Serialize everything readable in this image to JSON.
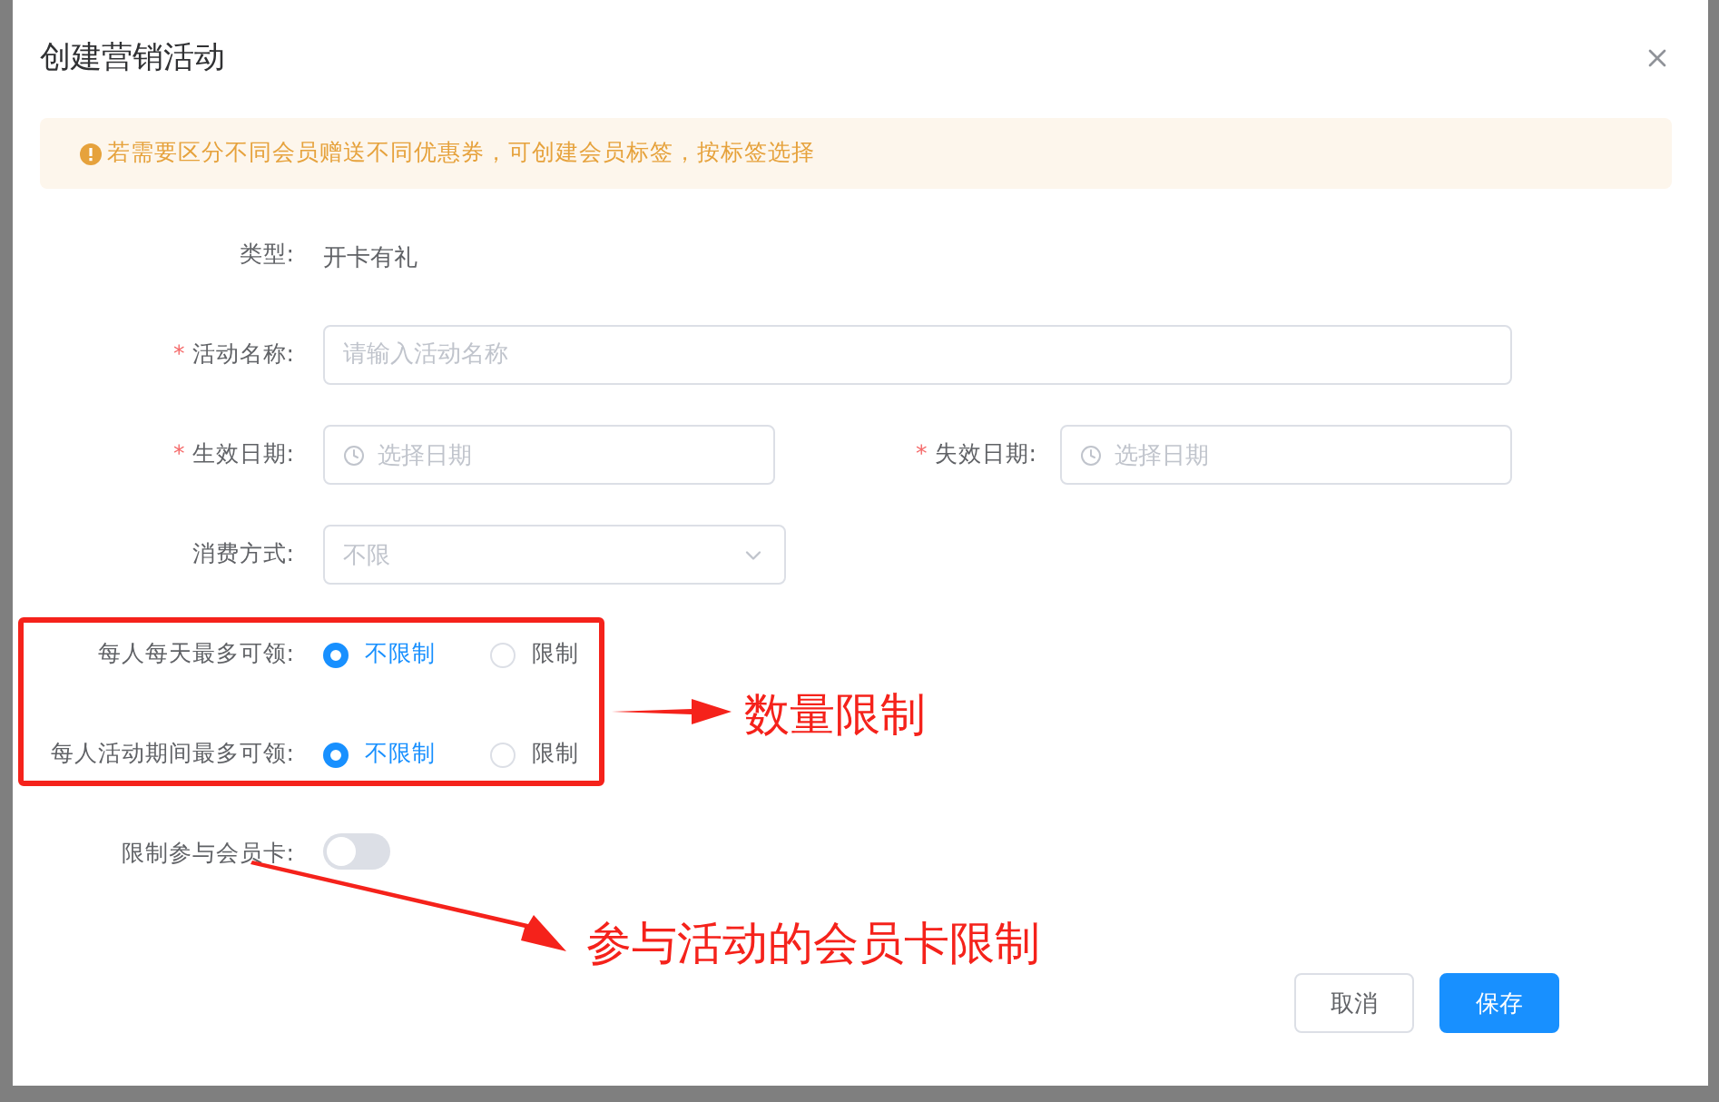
{
  "dialog": {
    "title": "创建营销活动"
  },
  "alert": {
    "text": "若需要区分不同会员赠送不同优惠券，可创建会员标签，按标签选择"
  },
  "form": [
    {
      "kind": "static",
      "label": "类型:",
      "value": "开卡有礼"
    },
    {
      "kind": "input",
      "mark": "*",
      "label": "活动名称:",
      "placeholder": "请输入活动名称"
    },
    {
      "kind": "dates",
      "mark": "*",
      "label": "生效日期:",
      "placeholder": "选择日期",
      "mark_2": "*",
      "label_2": "失效日期:",
      "placeholder_2": "选择日期"
    },
    {
      "kind": "select",
      "label": "消费方式:",
      "placeholder": "不限"
    },
    {
      "kind": "radio",
      "label": "每人每天最多可领:",
      "options": [
        {
          "label": "不限制",
          "selected": true
        },
        {
          "label": "限制",
          "selected": false
        }
      ]
    },
    {
      "kind": "radio",
      "label": "每人活动期间最多可领:",
      "options": [
        {
          "label": "不限制",
          "selected": true
        },
        {
          "label": "限制",
          "selected": false
        }
      ]
    },
    {
      "kind": "switch",
      "label": "限制参与会员卡:",
      "on": false
    }
  ],
  "buttons": [
    {
      "label": "取消",
      "kind": "default"
    },
    {
      "label": "保存",
      "kind": "primary"
    }
  ],
  "annotations": [
    {
      "text": "数量限制"
    },
    {
      "text": "参与活动的会员卡限制"
    }
  ]
}
